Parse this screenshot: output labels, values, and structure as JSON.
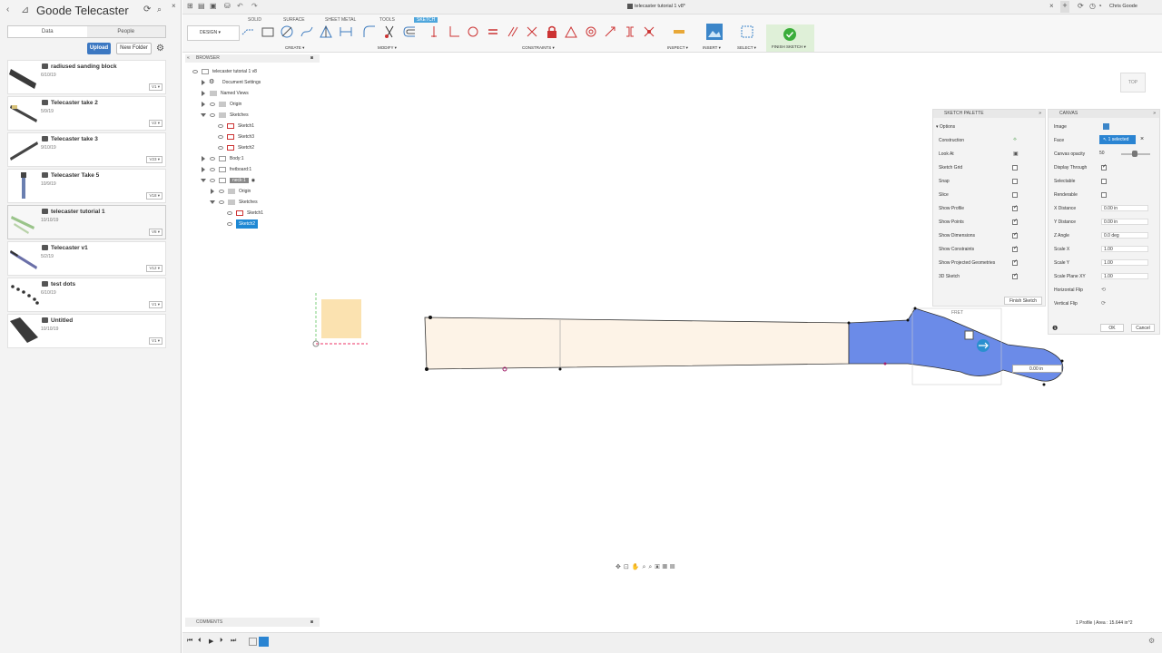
{
  "project": {
    "title": "Goode Telecaster",
    "tabs": [
      "Data",
      "People"
    ],
    "upload": "Upload",
    "new_folder": "New Folder"
  },
  "files": [
    {
      "name": "radiused sanding block",
      "date": "6/10/19",
      "version": "V1 ▾"
    },
    {
      "name": "Telecaster take 2",
      "date": "5/9/19",
      "version": "V2 ▾"
    },
    {
      "name": "Telecaster take 3",
      "date": "9/10/19",
      "version": "V23 ▾"
    },
    {
      "name": "Telecaster Take 5",
      "date": "10/9/19",
      "version": "V18 ▾"
    },
    {
      "name": "telecaster tutorial 1",
      "date": "10/10/19",
      "version": "V8 ▾"
    },
    {
      "name": "Telecaster v1",
      "date": "5/2/19",
      "version": "V12 ▾"
    },
    {
      "name": "test dots",
      "date": "6/10/19",
      "version": "V1 ▾"
    },
    {
      "name": "Untitled",
      "date": "10/10/19",
      "version": "V1 ▾"
    }
  ],
  "topbar": {
    "doc_title": "telecaster tutorial 1 v8*",
    "user": "Chris Goode"
  },
  "toolbar": {
    "design": "DESIGN ▾",
    "tabs": [
      "SOLID",
      "SURFACE",
      "SHEET METAL",
      "TOOLS",
      "SKETCH"
    ],
    "groups": {
      "create": "CREATE ▾",
      "modify": "MODIFY ▾",
      "constraints": "CONSTRAINTS ▾",
      "inspect": "INSPECT ▾",
      "insert": "INSERT ▾",
      "select": "SELECT ▾",
      "finish": "FINISH SKETCH ▾"
    }
  },
  "browser": {
    "header": "BROWSER",
    "rows": [
      "telecaster tutorial 1 v8",
      "Document Settings",
      "Named Views",
      "Origin",
      "Sketches",
      "Sketch1",
      "Sketch3",
      "Sketch2",
      "Body:1",
      "fretboard:1",
      "neck:1",
      "Origin",
      "Sketches",
      "Sketch1",
      "Sketch2"
    ]
  },
  "sketch_palette": {
    "title": "SKETCH PALETTE",
    "section": "Options",
    "rows": [
      "Construction",
      "Look At",
      "Sketch Grid",
      "Snap",
      "Slice",
      "Show Profile",
      "Show Points",
      "Show Dimensions",
      "Show Constraints",
      "Show Projected Geometries",
      "3D Sketch"
    ],
    "finish": "Finish Sketch"
  },
  "canvas_panel": {
    "title": "CANVAS",
    "labels": [
      "Image",
      "Face",
      "Canvas opacity",
      "Display Through",
      "Selectable",
      "Renderable",
      "X Distance",
      "Y Distance",
      "Z Angle",
      "Scale X",
      "Scale Y",
      "Scale Plane XY",
      "Horizontal Flip",
      "Vertical Flip"
    ],
    "face_value": "1 selected",
    "opacity": "50",
    "x_distance": "0.00 in",
    "y_distance": "0.00 in",
    "z_angle": "0.0 deg",
    "scale_x": "1.00",
    "scale_y": "1.00",
    "scale_xy": "1.00",
    "ok": "OK",
    "cancel": "Cancel"
  },
  "viewport": {
    "viewcube": "TOP",
    "dim_input": "0.00 in",
    "fret_label": "FRET",
    "status": "1 Profile | Area : 15.644 in^2"
  },
  "comments": "COMMENTS"
}
